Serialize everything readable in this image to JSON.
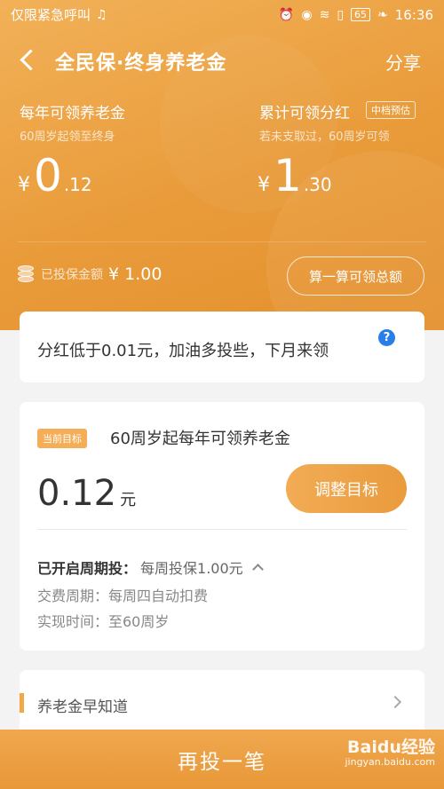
{
  "status_bar": {
    "carrier": "仅限紧急呼叫",
    "battery": "65",
    "time": "16:36"
  },
  "nav": {
    "title": "全民保·终身养老金",
    "share_label": "分享"
  },
  "annual": {
    "label": "每年可领养老金",
    "sub": "60周岁起领至终身",
    "currency": "¥",
    "int": "0",
    "dec": ".12"
  },
  "dividend": {
    "label": "累计可领分红",
    "badge": "中档预估",
    "sub": "若未支取过，60周岁可领",
    "currency": "¥",
    "int": "1",
    "dec": ".30"
  },
  "insured": {
    "label": "已投保金额",
    "value": "¥ 1.00"
  },
  "calc_button": "算一算可领总额",
  "tip": {
    "text": "分红低于0.01元，加油多投些，下月来领",
    "help": "?"
  },
  "goal": {
    "tag": "当前目标",
    "title": "60周岁起每年可领养老金",
    "value": "0.12",
    "unit": "元",
    "adjust_button": "调整目标",
    "period_label": "已开启周期投：",
    "period_value": "每周投保1.00元",
    "pay_cycle": "交费周期：每周四自动扣费",
    "realize_time": "实现时间：至60周岁"
  },
  "knowledge": {
    "title": "养老金早知道"
  },
  "bottom_button": "再投一笔",
  "watermark": {
    "line1": "Baidu经验",
    "line2": "jingyan.baidu.com"
  }
}
